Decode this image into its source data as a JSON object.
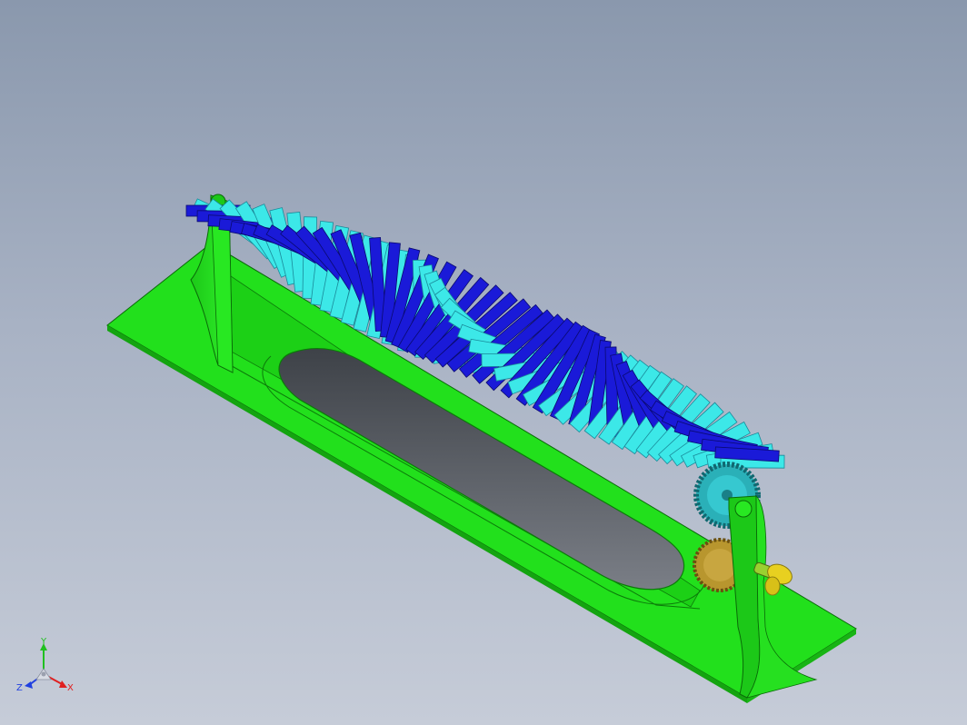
{
  "viewport": {
    "background_top": "#8a98ad",
    "background_bottom": "#c6ccd8"
  },
  "model": {
    "base_color": "#22e01c",
    "base_dark": "#12a80e",
    "blade_dark_color": "#1a1ad8",
    "blade_light_color": "#3ce8e8",
    "gear_color": "#2ab0b8",
    "gear_brass_color": "#b8962e",
    "handle_color": "#e8d020",
    "slot_color": "#5a5e66"
  },
  "triad": {
    "x_label": "X",
    "y_label": "Y",
    "z_label": "Z",
    "x_color": "#e02020",
    "y_color": "#20c020",
    "z_color": "#2040e0"
  }
}
